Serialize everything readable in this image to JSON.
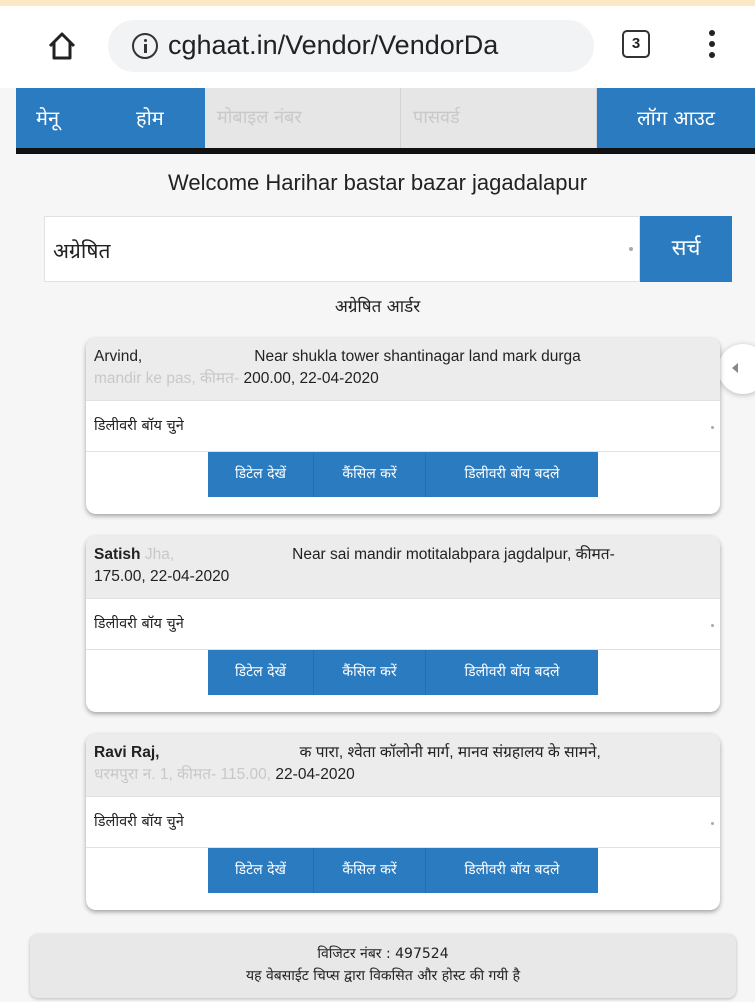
{
  "browser": {
    "url": "cghaat.in/Vendor/VendorDa",
    "tabs_count": "3"
  },
  "nav": {
    "menu": "मेनू",
    "home": "होम",
    "mobile_placeholder": "मोबाइल नंबर",
    "password_placeholder": "पासवर्ड",
    "logout": "लॉग आउट"
  },
  "welcome": "Welcome Harihar bastar bazar jagadalapur",
  "filter": {
    "selected": "अग्रेषित",
    "search_label": "सर्च"
  },
  "section_title": "अग्रेषित आर्डर",
  "orders": [
    {
      "line1_visible": "Arvind,",
      "line1_faded": "",
      "line1_rest": "Near shukla tower shantinagar land mark durga",
      "line2_faded": "mandir ke pas, कीमत- ",
      "line2_rest": "200.00, 22-04-2020",
      "delivery_select": "डिलीवरी बॉय चुने",
      "btn_details": "डिटेल देखें",
      "btn_cancel": "कैंसिल करें",
      "btn_change": "डिलीवरी बॉय बदले"
    },
    {
      "line1_visible": "Satish",
      "line1_faded": " Jha,",
      "line1_rest": "Near sai mandir motitalabpara jagdalpur, कीमत-",
      "line2_faded": "",
      "line2_rest": "175.00, 22-04-2020",
      "delivery_select": "डिलीवरी बॉय चुने",
      "btn_details": "डिटेल देखें",
      "btn_cancel": "कैंसिल करें",
      "btn_change": "डिलीवरी बॉय बदले"
    },
    {
      "line1_visible": "Ravi Raj,",
      "line1_faded": "",
      "line1_rest": "क पारा, श्वेता कॉलोनी मार्ग, मानव संग्रहालय के सामने,",
      "line2_faded": "धरमपुरा न. 1, कीमत- 115.00,",
      "line2_rest": " 22-04-2020",
      "delivery_select": "डिलीवरी बॉय चुने",
      "btn_details": "डिटेल देखें",
      "btn_cancel": "कैंसिल करें",
      "btn_change": "डिलीवरी बॉय बदले"
    }
  ],
  "footer": {
    "visitor": "विजिटर नंबर : 497524",
    "credit": "यह वेबसाईट चिप्स द्वारा विकसित और होस्ट की गयी है"
  },
  "colors": {
    "primary": "#2b7bc0",
    "nav_border": "#111111",
    "card_header": "#ececec"
  },
  "icons": {
    "home": "home-icon",
    "info": "info-icon",
    "tabs": "tabs-count-icon",
    "menu": "kebab-menu-icon",
    "side": "chevron-left-icon"
  }
}
